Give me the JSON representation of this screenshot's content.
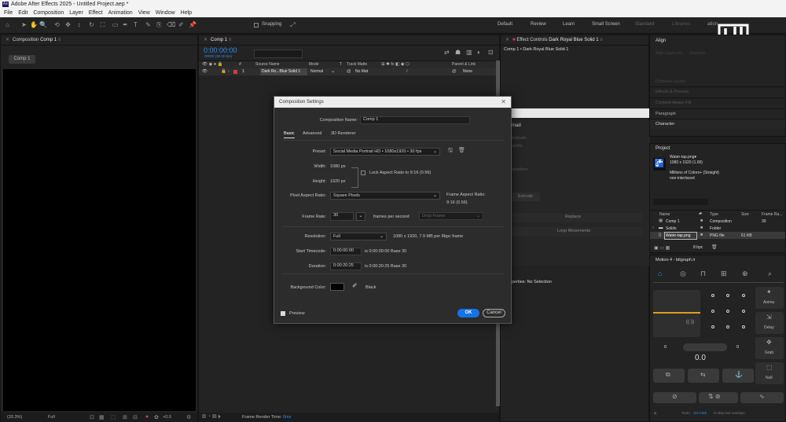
{
  "app": {
    "title": "Adobe After Effects 2025 - Untitled Project.aep *",
    "icon": "Ae"
  },
  "menu": [
    "File",
    "Edit",
    "Composition",
    "Layer",
    "Effect",
    "Animation",
    "View",
    "Window",
    "Help"
  ],
  "toolbar": {
    "snapping": "Snapping"
  },
  "workspaces": [
    "Default",
    "Review",
    "Learn",
    "Small Screen",
    "Standard",
    "Libraries",
    "ation"
  ],
  "comp_viewer": {
    "header": "Composition",
    "header_name": "Comp 1",
    "tab": "Comp 1",
    "zoom": "(33.3%)",
    "quality": "Full",
    "plus_value": "+0.0"
  },
  "timeline": {
    "header": "Comp 1",
    "timecode": "0:00:00:00",
    "timecode_sub": "00000 (30.00 fps)",
    "col_source": "Source Name",
    "col_mode": "Mode",
    "col_t": "T",
    "col_trackmatte": "Track Matte",
    "col_parent": "Parent & Link",
    "col_hash": "#",
    "layer_num": "1",
    "layer_name": "Dark Ro...Blue Solid 1",
    "layer_mode": "Normal",
    "layer_matte": "No Mat",
    "layer_parent": "None",
    "render_time_label": "Frame Render Time:",
    "render_time_value": "0ms"
  },
  "effect_controls": {
    "header": "Effect Controls",
    "header_name": "Dark Royal Blue Solid 1",
    "subtitle": "Comp 1 • Dark Royal Blue Solid 1"
  },
  "hidden_panel": {
    "title": "mad",
    "items": [
      "Extrude",
      "epths",
      "epetition"
    ],
    "buttons": [
      "Extrude",
      "Replace",
      "Loop Movements"
    ],
    "properties": "perties: No Selection"
  },
  "right_stack": {
    "align": "Align",
    "align_sub": "Align Layers to:",
    "align_sub2": "Selection",
    "distribute": "Distribute Layers:",
    "effects": "Effects & Presets",
    "content_aware": "Content-Aware Fill",
    "paragraph": "Paragraph",
    "character": "Character"
  },
  "project": {
    "header": "Project",
    "file_name": "Water-tap.png▾",
    "file_size": "1080 x 1920 (1.00)",
    "file_color": "Millions of Colors+ (Straight)",
    "file_interlace": "non-interlaced",
    "cols": {
      "name": "Name",
      "type": "Type",
      "size": "Size",
      "frame_rate": "Frame Ra..."
    },
    "items": [
      {
        "name": "Comp 1",
        "type": "Composition",
        "size": "",
        "fr": "30"
      },
      {
        "name": "Solids",
        "type": "Folder",
        "size": "",
        "fr": ""
      },
      {
        "name": "Water-tap.png",
        "type": "PNG file",
        "size": "61 KB",
        "fr": ""
      }
    ],
    "bpc": "8 bpc"
  },
  "motion4": {
    "header": "Motion 4 - bitgraph.ir",
    "side_labels": [
      "Anima",
      "Delay",
      "Grab",
      "Null"
    ],
    "spin_left": "0",
    "spin_right": "0",
    "counter": "0.0",
    "tip_prefix": "Tools:",
    "tip_key": "ctrl+click",
    "tip_suffix": "to skip tool overlays"
  },
  "dialog": {
    "title": "Composition Settings",
    "name_label": "Composition Name:",
    "name_value": "Comp 1",
    "tabs": [
      "Basic",
      "Advanced",
      "3D Renderer"
    ],
    "preset_label": "Preset:",
    "preset_value": "Social Media Portrait HD  •  1080x1920 • 30 fps",
    "width_label": "Width:",
    "width_value": "1080 px",
    "height_label": "Height:",
    "height_value": "1920 px",
    "lock_label": "Lock Aspect Ratio to 9:16 (0.56)",
    "par_label": "Pixel Aspect Ratio:",
    "par_value": "Square Pixels",
    "far_label": "Frame Aspect Ratio:",
    "far_value": "9:16 (0.56)",
    "fps_label": "Frame Rate:",
    "fps_value": "30",
    "fps_unit": "frames per second",
    "drop_frame": "Drop Frame",
    "res_label": "Resolution:",
    "res_value": "Full",
    "res_info": "1080 x 1920, 7.9 MB per 8bpc frame",
    "start_label": "Start Timecode:",
    "start_value": "0:00:00:00",
    "start_info": "is 0:00:00:00  Base 30",
    "dur_label": "Duration:",
    "dur_value": "0:00:20:25",
    "dur_info": "is 0:00:20:25  Base 30",
    "bg_label": "Background Color:",
    "bg_name": "Black",
    "preview_label": "Preview",
    "ok": "OK",
    "cancel": "Cancel"
  }
}
